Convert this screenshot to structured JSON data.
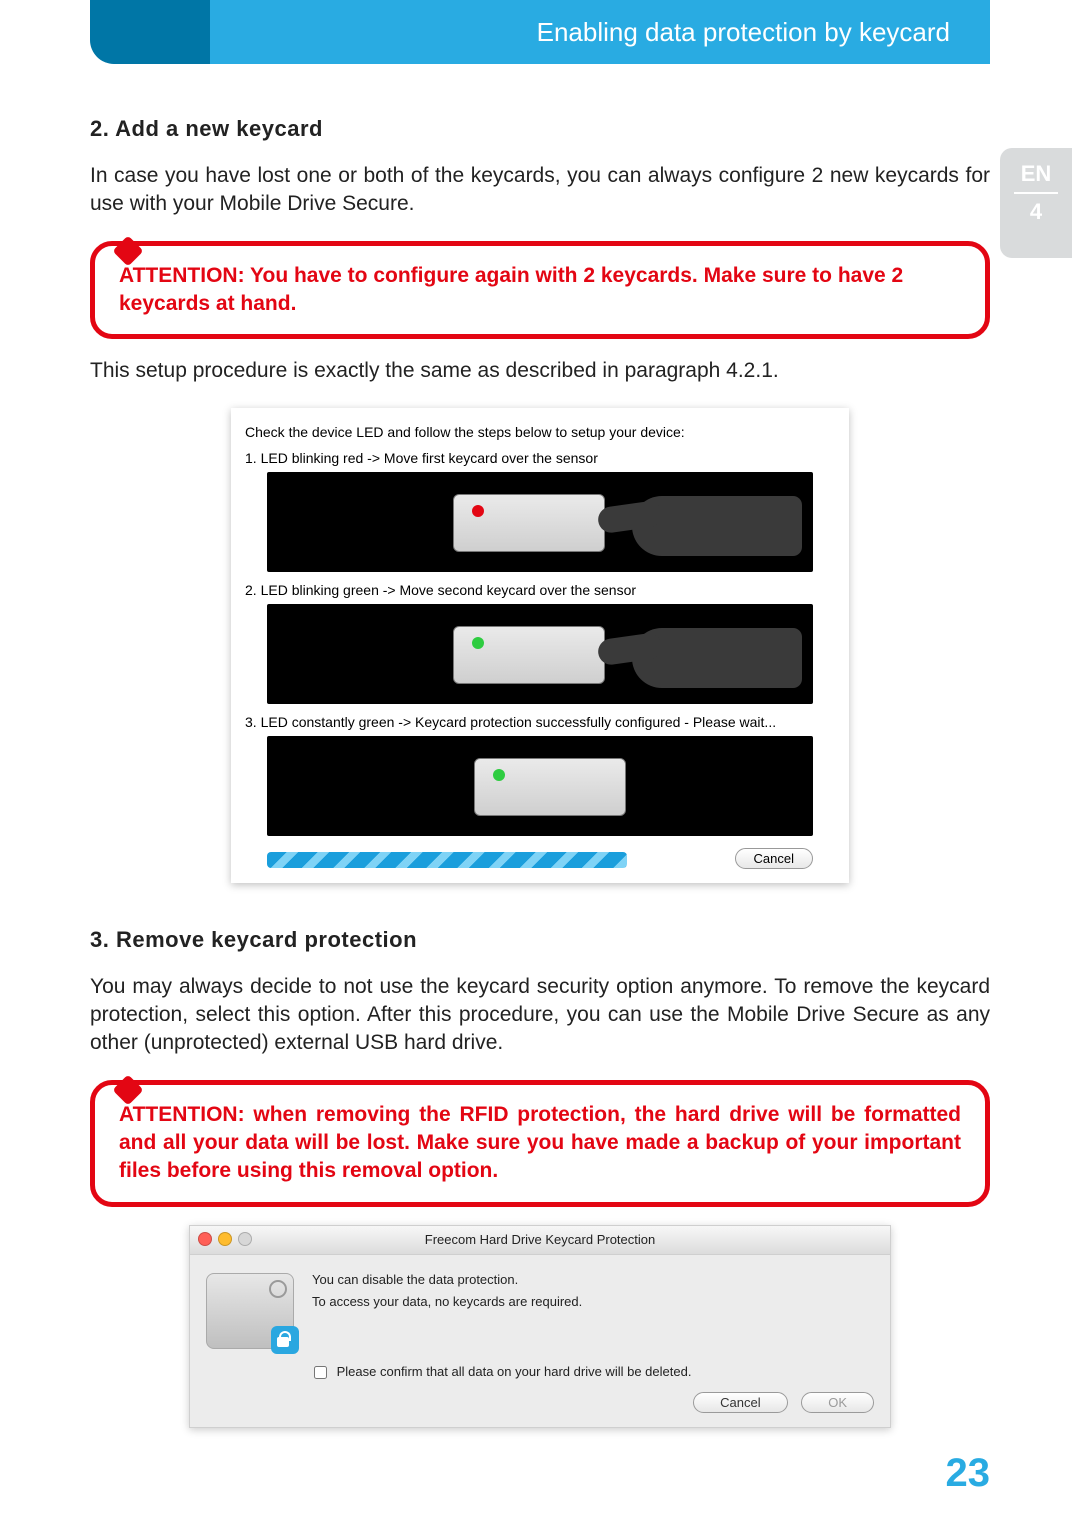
{
  "header": {
    "title": "Enabling data protection by keycard"
  },
  "langtab": {
    "lang": "EN",
    "chapter": "4"
  },
  "section2": {
    "heading": "2. Add a new keycard",
    "para": "In case you have lost one or both of the keycards, you can always configure 2 new keycards for use with your Mobile Drive Secure.",
    "attention": "ATTENTION: You have to configure again with 2 keycards. Make sure to have 2 keycards at hand.",
    "after": "This setup procedure is exactly the same as described in paragraph 4.2.1."
  },
  "wizard": {
    "intro": "Check the device LED and follow the steps below to setup your device:",
    "step1": "1. LED blinking red -> Move first keycard over the sensor",
    "step2": "2. LED blinking green -> Move second keycard over the sensor",
    "step3": "3. LED constantly green -> Keycard protection successfully configured - Please wait...",
    "cancel": "Cancel"
  },
  "section3": {
    "heading": "3. Remove keycard protection",
    "para": "You may always decide to not use the keycard security option anymore. To remove the keycard protection, select this option. After this procedure, you can use the Mobile Drive Secure as any other (unprotected) external USB hard drive.",
    "attention": "ATTENTION: when removing the RFID protection, the hard drive will be formatted and all your data will be lost. Make sure you have made a backup of your important files before using this removal option."
  },
  "disableDialog": {
    "title": "Freecom Hard Drive Keycard Protection",
    "line1": "You can disable the data protection.",
    "line2": "To access your data, no keycards are required.",
    "confirm": "Please confirm that all data on your hard drive will be deleted.",
    "cancel": "Cancel",
    "ok": "OK"
  },
  "pageNumber": "23"
}
